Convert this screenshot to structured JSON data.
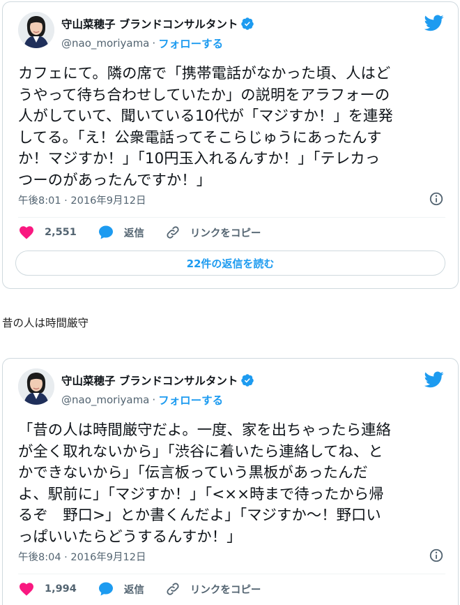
{
  "colors": {
    "accent": "#1d9bf0",
    "like": "#f91880",
    "text": "#0f1419",
    "muted": "#536471",
    "border": "#cfd9de"
  },
  "caption": "昔の人は時間厳守",
  "tweets": [
    {
      "display_name": "守山菜穂子 ブランドコンサルタント",
      "handle": "@nao_moriyama",
      "separator": "·",
      "follow_label": "フォローする",
      "text": "カフェにて。隣の席で「携帯電話がなかった頃、人はど\nうやって待ち合わせしていたか」の説明をアラフォーの\n人がしていて、聞いている10代が「マジすか！」を連発\nしてる。「え！公衆電話ってそこらじゅうにあったんす\nか！マジすか！」「10円玉入れるんすか！」「テレカっ\nつーのがあったんですか！」",
      "timestamp": "午後8:01 · 2016年9月12日",
      "likes": "2,551",
      "reply_label": "返信",
      "copy_link_label": "リンクをコピー",
      "read_replies_label": "22件の返信を読む",
      "icons": [
        "bird-icon",
        "verified-icon",
        "info-icon",
        "heart-icon",
        "reply-icon",
        "link-icon"
      ]
    },
    {
      "display_name": "守山菜穂子 ブランドコンサルタント",
      "handle": "@nao_moriyama",
      "separator": "·",
      "follow_label": "フォローする",
      "text": "「昔の人は時間厳守だよ。一度、家を出ちゃったら連絡\nが全く取れないから」「渋谷に着いたら連絡してね、と\nかできないから」「伝言板っていう黒板があったんだ\nよ、駅前に」「マジすか！」「<××時まで待ったから帰\nるぞ　野口>」とか書くんだよ」「マジすか〜！野口い\nっぱいいたらどうするんすか！」",
      "timestamp": "午後8:04 · 2016年9月12日",
      "likes": "1,994",
      "reply_label": "返信",
      "copy_link_label": "リンクをコピー"
    }
  ]
}
